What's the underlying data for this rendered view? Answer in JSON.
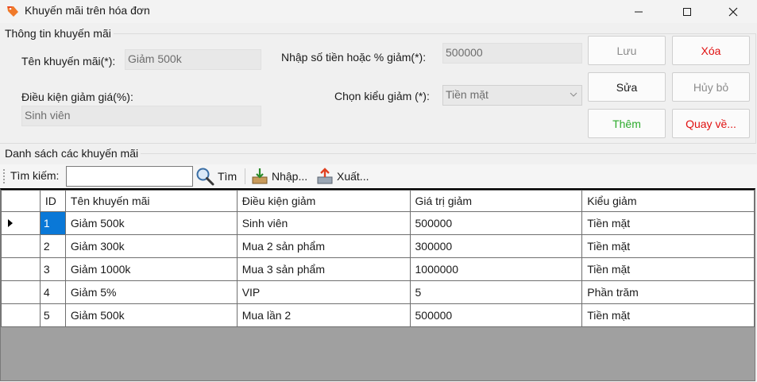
{
  "window": {
    "title": "Khuyến mãi trên hóa đơn"
  },
  "info_group": {
    "caption": "Thông tin khuyến mãi",
    "name_label": "Tên khuyến mãi(*):",
    "name_value": "Giảm 500k",
    "amount_label": "Nhập số tiền hoặc % giảm(*):",
    "amount_value": "500000",
    "condition_label": "Điều kiện giảm giá(%):",
    "condition_value": "Sinh viên",
    "type_label": "Chọn kiểu giảm (*):",
    "type_value": "Tiền mặt"
  },
  "buttons": {
    "save": "Lưu",
    "delete": "Xóa",
    "edit": "Sửa",
    "cancel": "Hủy bỏ",
    "add": "Thêm",
    "back": "Quay về..."
  },
  "list_group": {
    "caption": "Danh sách các khuyến mãi"
  },
  "toolbar": {
    "search_label": "Tìm kiếm:",
    "search_value": "",
    "search_button": "Tìm",
    "import_button": "Nhập...",
    "export_button": "Xuất..."
  },
  "table": {
    "columns": [
      "ID",
      "Tên khuyến mãi",
      "Điều kiện giảm",
      "Giá trị giảm",
      "Kiểu giảm"
    ],
    "rows": [
      [
        "1",
        "Giảm 500k",
        "Sinh viên",
        "500000",
        "Tiền mặt"
      ],
      [
        "2",
        "Giảm 300k",
        "Mua 2 sản phẩm",
        "300000",
        "Tiền mặt"
      ],
      [
        "3",
        "Giảm 1000k",
        "Mua 3 sản phẩm",
        "1000000",
        "Tiền mặt"
      ],
      [
        "4",
        "Giảm 5%",
        "VIP",
        "5",
        "Phần trăm"
      ],
      [
        "5",
        "Giảm 500k",
        "Mua lần 2",
        "500000",
        "Tiền mặt"
      ]
    ],
    "selected_row": 0
  },
  "colors": {
    "accent_selection": "#0a78d7",
    "danger_text": "#e01010",
    "success_text": "#2dab2d"
  }
}
